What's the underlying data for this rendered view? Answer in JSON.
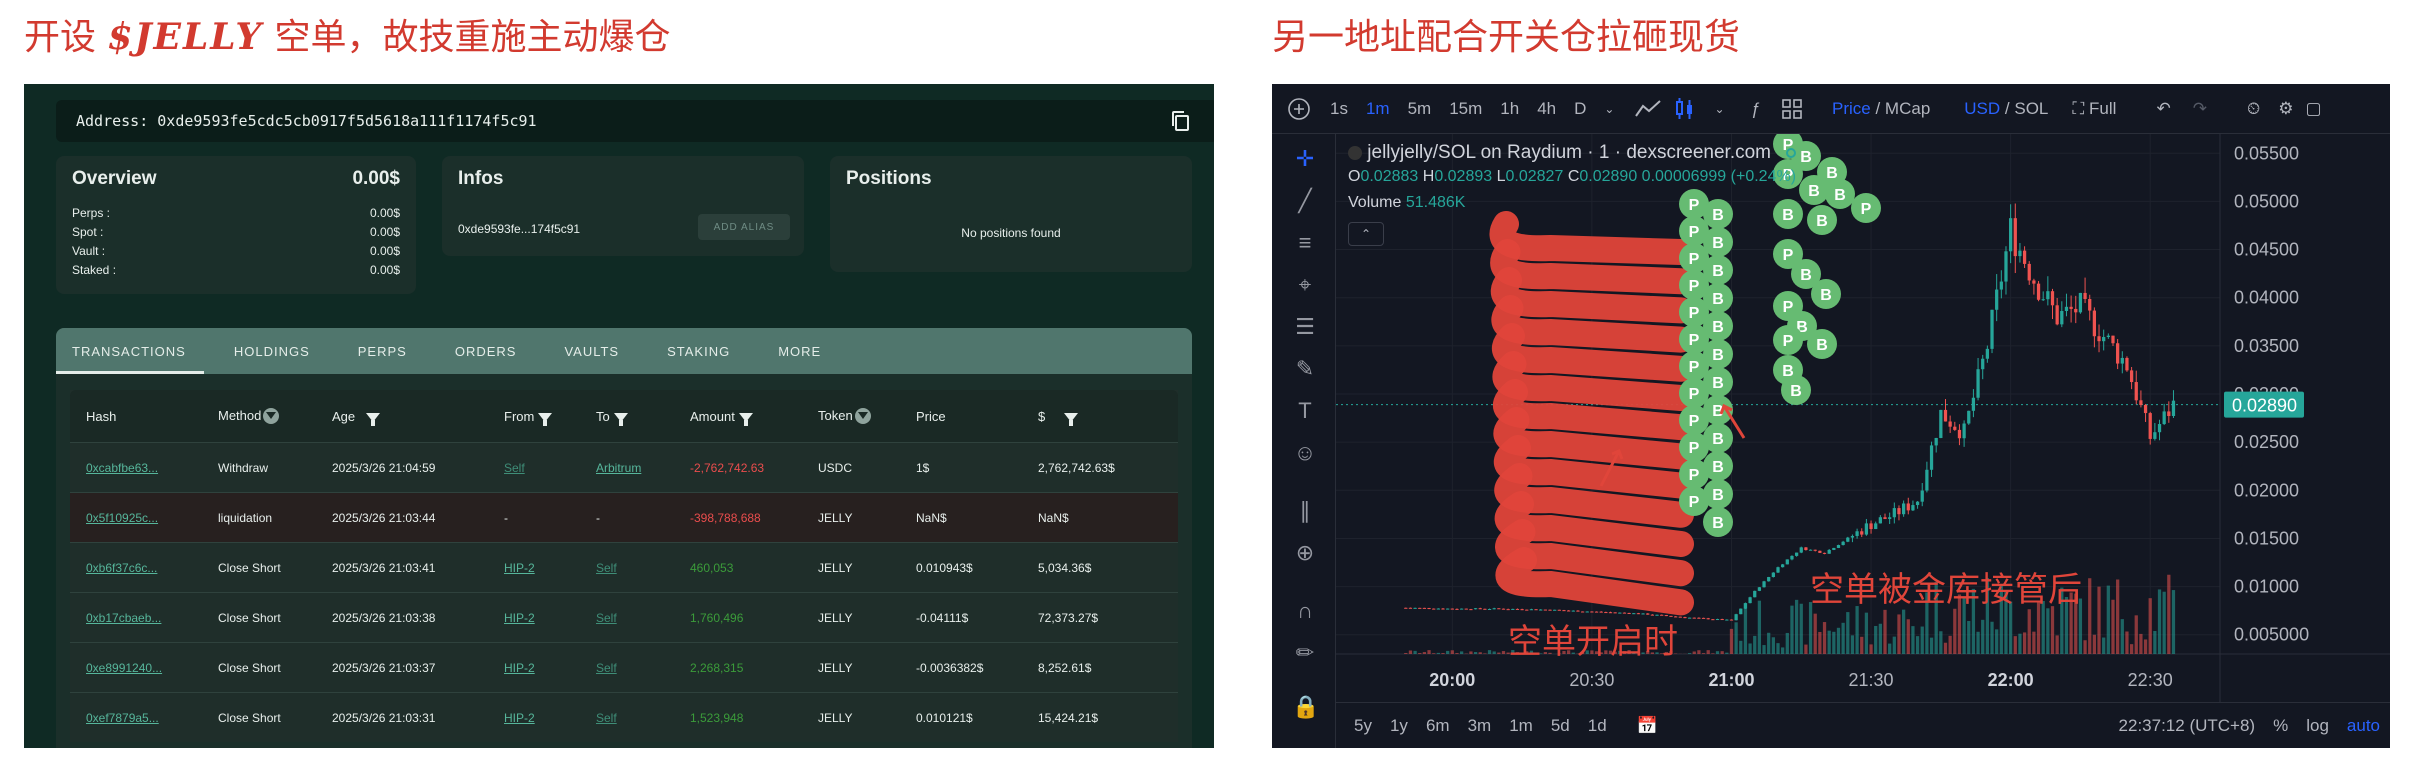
{
  "captions": {
    "left_prefix": "开设",
    "left_brand": "$JELLY",
    "left_suffix": "空单，故技重施主动爆仓",
    "right": "另一地址配合开关仓拉砸现货"
  },
  "wallet": {
    "address_label": "Address:",
    "address": "0xde9593fe5cdc5cb0917f5d5618a111f1174f5c91"
  },
  "overview": {
    "title": "Overview",
    "total": "0.00$",
    "rows": [
      {
        "label": "Perps :",
        "value": "0.00$"
      },
      {
        "label": "Spot :",
        "value": "0.00$"
      },
      {
        "label": "Vault :",
        "value": "0.00$"
      },
      {
        "label": "Staked :",
        "value": "0.00$"
      }
    ]
  },
  "infos": {
    "title": "Infos",
    "short_address": "0xde9593fe...174f5c91",
    "alias_button": "ADD ALIAS"
  },
  "positions": {
    "title": "Positions",
    "empty": "No positions found"
  },
  "tabs": [
    "TRANSACTIONS",
    "HOLDINGS",
    "PERPS",
    "ORDERS",
    "VAULTS",
    "STAKING",
    "MORE"
  ],
  "table": {
    "headers": {
      "hash": "Hash",
      "method": "Method",
      "age": "Age",
      "from": "From",
      "to": "To",
      "amount": "Amount",
      "token": "Token",
      "price": "Price",
      "usd": "$"
    },
    "rows": [
      {
        "hash": "0xcabfbe63...",
        "method": "Withdraw",
        "age": "2025/3/26 21:04:59",
        "from": "Self",
        "to": "Arbitrum",
        "amount": "-2,762,742.63",
        "sign": "neg",
        "token": "USDC",
        "price": "1$",
        "usd": "2,762,742.63$"
      },
      {
        "hash": "0x5f10925c...",
        "method": "liquidation",
        "age": "2025/3/26 21:03:44",
        "from": "-",
        "to": "-",
        "amount": "-398,788,688",
        "sign": "neg",
        "token": "JELLY",
        "price": "NaN$",
        "usd": "NaN$"
      },
      {
        "hash": "0xb6f37c6c...",
        "method": "Close Short",
        "age": "2025/3/26 21:03:41",
        "from": "HIP-2",
        "to": "Self",
        "amount": "460,053",
        "sign": "pos",
        "token": "JELLY",
        "price": "0.010943$",
        "usd": "5,034.36$"
      },
      {
        "hash": "0xb17cbaeb...",
        "method": "Close Short",
        "age": "2025/3/26 21:03:38",
        "from": "HIP-2",
        "to": "Self",
        "amount": "1,760,496",
        "sign": "pos",
        "token": "JELLY",
        "price": "-0.04111$",
        "usd": "72,373.27$"
      },
      {
        "hash": "0xe8991240...",
        "method": "Close Short",
        "age": "2025/3/26 21:03:37",
        "from": "HIP-2",
        "to": "Self",
        "amount": "2,268,315",
        "sign": "pos",
        "token": "JELLY",
        "price": "-0.0036382$",
        "usd": "8,252.61$"
      },
      {
        "hash": "0xef7879a5...",
        "method": "Close Short",
        "age": "2025/3/26 21:03:31",
        "from": "HIP-2",
        "to": "Self",
        "amount": "1,523,948",
        "sign": "pos",
        "token": "JELLY",
        "price": "0.010121$",
        "usd": "15,424.21$"
      }
    ]
  },
  "chart": {
    "toolbar": {
      "intervals": [
        "1s",
        "1m",
        "5m",
        "15m",
        "1h",
        "4h",
        "D"
      ],
      "active_interval": "1m",
      "price": "Price",
      "mcap": "/ MCap",
      "usd": "USD",
      "sol": "/ SOL",
      "full": "Full"
    },
    "legend": "jellyjelly/SOL on Raydium · 1 · dexscreener.com",
    "ohlc": {
      "o": "0.02883",
      "h": "0.02893",
      "l": "0.02827",
      "c": "0.02890",
      "change": "0.00006999 (+0.24%)"
    },
    "volume_label": "Volume",
    "volume": "51.486K",
    "annotations": {
      "open": "空单开启时",
      "after": "空单被金库接管后"
    },
    "bottom": {
      "ranges": [
        "5y",
        "1y",
        "6m",
        "3m",
        "1m",
        "5d",
        "1d"
      ],
      "time": "22:37:12 (UTC+8)",
      "pct": "%",
      "log": "log",
      "auto": "auto"
    },
    "bubble_letters": {
      "p": "P",
      "b": "B"
    },
    "colors": {
      "up": "#26a69a",
      "down": "#ef5350",
      "bg": "#131722",
      "bubble": "#66bb72",
      "scribble": "#e0453a"
    }
  },
  "chart_data": {
    "type": "candlestick",
    "title": "jellyjelly/SOL on Raydium · 1 · dexscreener.com",
    "x_ticks": [
      "20:00",
      "20:30",
      "21:00",
      "21:30",
      "22:00",
      "22:30"
    ],
    "y_ticks": [
      "0.05500",
      "0.05000",
      "0.04500",
      "0.04000",
      "0.03500",
      "0.03000",
      "0.02500",
      "0.02000",
      "0.01500",
      "0.01000",
      "0.005000"
    ],
    "ylim": [
      0.003,
      0.057
    ],
    "last_price": "0.02890",
    "series": [
      {
        "x": [
          "19:50",
          "20:00",
          "20:10",
          "20:20",
          "20:30",
          "20:40",
          "20:50",
          "21:00",
          "21:05",
          "21:10",
          "21:15",
          "21:20",
          "21:25",
          "21:30",
          "21:35",
          "21:40",
          "21:45",
          "21:50",
          "21:55",
          "22:00",
          "22:05",
          "22:10",
          "22:15",
          "22:20",
          "22:25",
          "22:30",
          "22:35"
        ],
        "values": [
          0.0078,
          0.0077,
          0.0077,
          0.0076,
          0.0074,
          0.0072,
          0.0068,
          0.0065,
          0.0095,
          0.012,
          0.014,
          0.0135,
          0.015,
          0.0165,
          0.0175,
          0.019,
          0.028,
          0.026,
          0.035,
          0.047,
          0.042,
          0.038,
          0.039,
          0.036,
          0.033,
          0.0255,
          0.0289
        ]
      }
    ]
  }
}
